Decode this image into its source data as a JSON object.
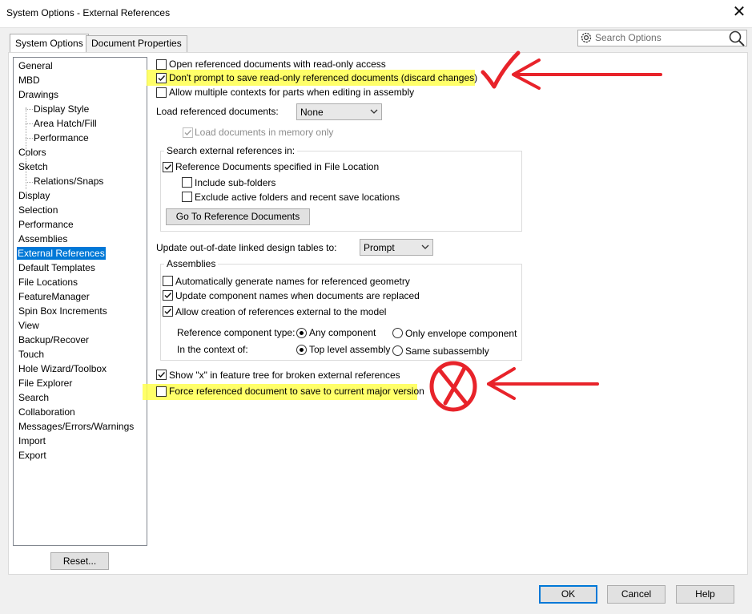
{
  "window": {
    "title": "System Options - External References"
  },
  "tabs": [
    {
      "label": "System Options",
      "active": true
    },
    {
      "label": "Document Properties",
      "active": false
    }
  ],
  "search": {
    "placeholder": "Search Options"
  },
  "tree": {
    "items": [
      {
        "label": "General",
        "level": 0
      },
      {
        "label": "MBD",
        "level": 0
      },
      {
        "label": "Drawings",
        "level": 0
      },
      {
        "label": "Display Style",
        "level": 1
      },
      {
        "label": "Area Hatch/Fill",
        "level": 1
      },
      {
        "label": "Performance",
        "level": 1
      },
      {
        "label": "Colors",
        "level": 0
      },
      {
        "label": "Sketch",
        "level": 0
      },
      {
        "label": "Relations/Snaps",
        "level": 1
      },
      {
        "label": "Display",
        "level": 0
      },
      {
        "label": "Selection",
        "level": 0
      },
      {
        "label": "Performance",
        "level": 0
      },
      {
        "label": "Assemblies",
        "level": 0
      },
      {
        "label": "External References",
        "level": 0,
        "selected": true
      },
      {
        "label": "Default Templates",
        "level": 0
      },
      {
        "label": "File Locations",
        "level": 0
      },
      {
        "label": "FeatureManager",
        "level": 0
      },
      {
        "label": "Spin Box Increments",
        "level": 0
      },
      {
        "label": "View",
        "level": 0
      },
      {
        "label": "Backup/Recover",
        "level": 0
      },
      {
        "label": "Touch",
        "level": 0
      },
      {
        "label": "Hole Wizard/Toolbox",
        "level": 0
      },
      {
        "label": "File Explorer",
        "level": 0
      },
      {
        "label": "Search",
        "level": 0
      },
      {
        "label": "Collaboration",
        "level": 0
      },
      {
        "label": "Messages/Errors/Warnings",
        "level": 0
      },
      {
        "label": "Import",
        "level": 0
      },
      {
        "label": "Export",
        "level": 0
      }
    ]
  },
  "options": {
    "open_read_only": {
      "label": "Open referenced documents with read-only access",
      "checked": false
    },
    "dont_prompt_save": {
      "label": "Don't prompt to save read-only referenced documents (discard changes)",
      "checked": true
    },
    "allow_multiple_contexts": {
      "label": "Allow multiple contexts for parts when editing in assembly",
      "checked": false
    },
    "load_referenced_label": "Load referenced documents:",
    "load_referenced_value": "None",
    "load_in_memory": {
      "label": "Load documents in memory only",
      "checked": true,
      "disabled": true
    }
  },
  "search_group": {
    "title": "Search external references in:",
    "ref_docs": {
      "label": "Reference Documents specified in File Location",
      "checked": true
    },
    "include_sub": {
      "label": "Include sub-folders",
      "checked": false
    },
    "exclude_active": {
      "label": "Exclude active folders and recent save locations",
      "checked": false
    },
    "goto_button": "Go To Reference Documents"
  },
  "design_tables": {
    "label": "Update out-of-date linked design tables to:",
    "value": "Prompt"
  },
  "assemblies_group": {
    "title": "Assemblies",
    "auto_names": {
      "label": "Automatically generate names for referenced geometry",
      "checked": false
    },
    "update_names": {
      "label": "Update component names when documents are replaced",
      "checked": true
    },
    "allow_external": {
      "label": "Allow creation of references external to the model",
      "checked": true
    },
    "ref_type_label": "Reference component type:",
    "any_component": {
      "label": "Any component",
      "selected": true
    },
    "only_envelope": {
      "label": "Only envelope component",
      "selected": false
    },
    "context_label": "In the context of:",
    "top_level": {
      "label": "Top level assembly",
      "selected": true
    },
    "same_sub": {
      "label": "Same subassembly",
      "selected": false
    }
  },
  "show_x": {
    "label": "Show \"x\" in feature tree for broken external references",
    "checked": true
  },
  "force_save": {
    "label": "Force referenced document to save to current major version",
    "checked": false
  },
  "buttons": {
    "reset": "Reset...",
    "ok": "OK",
    "cancel": "Cancel",
    "help": "Help"
  },
  "annotation_colors": {
    "highlight": "#ffff4f",
    "ink": "#e8232a"
  },
  "colors": {
    "accent": "#0078d7"
  }
}
